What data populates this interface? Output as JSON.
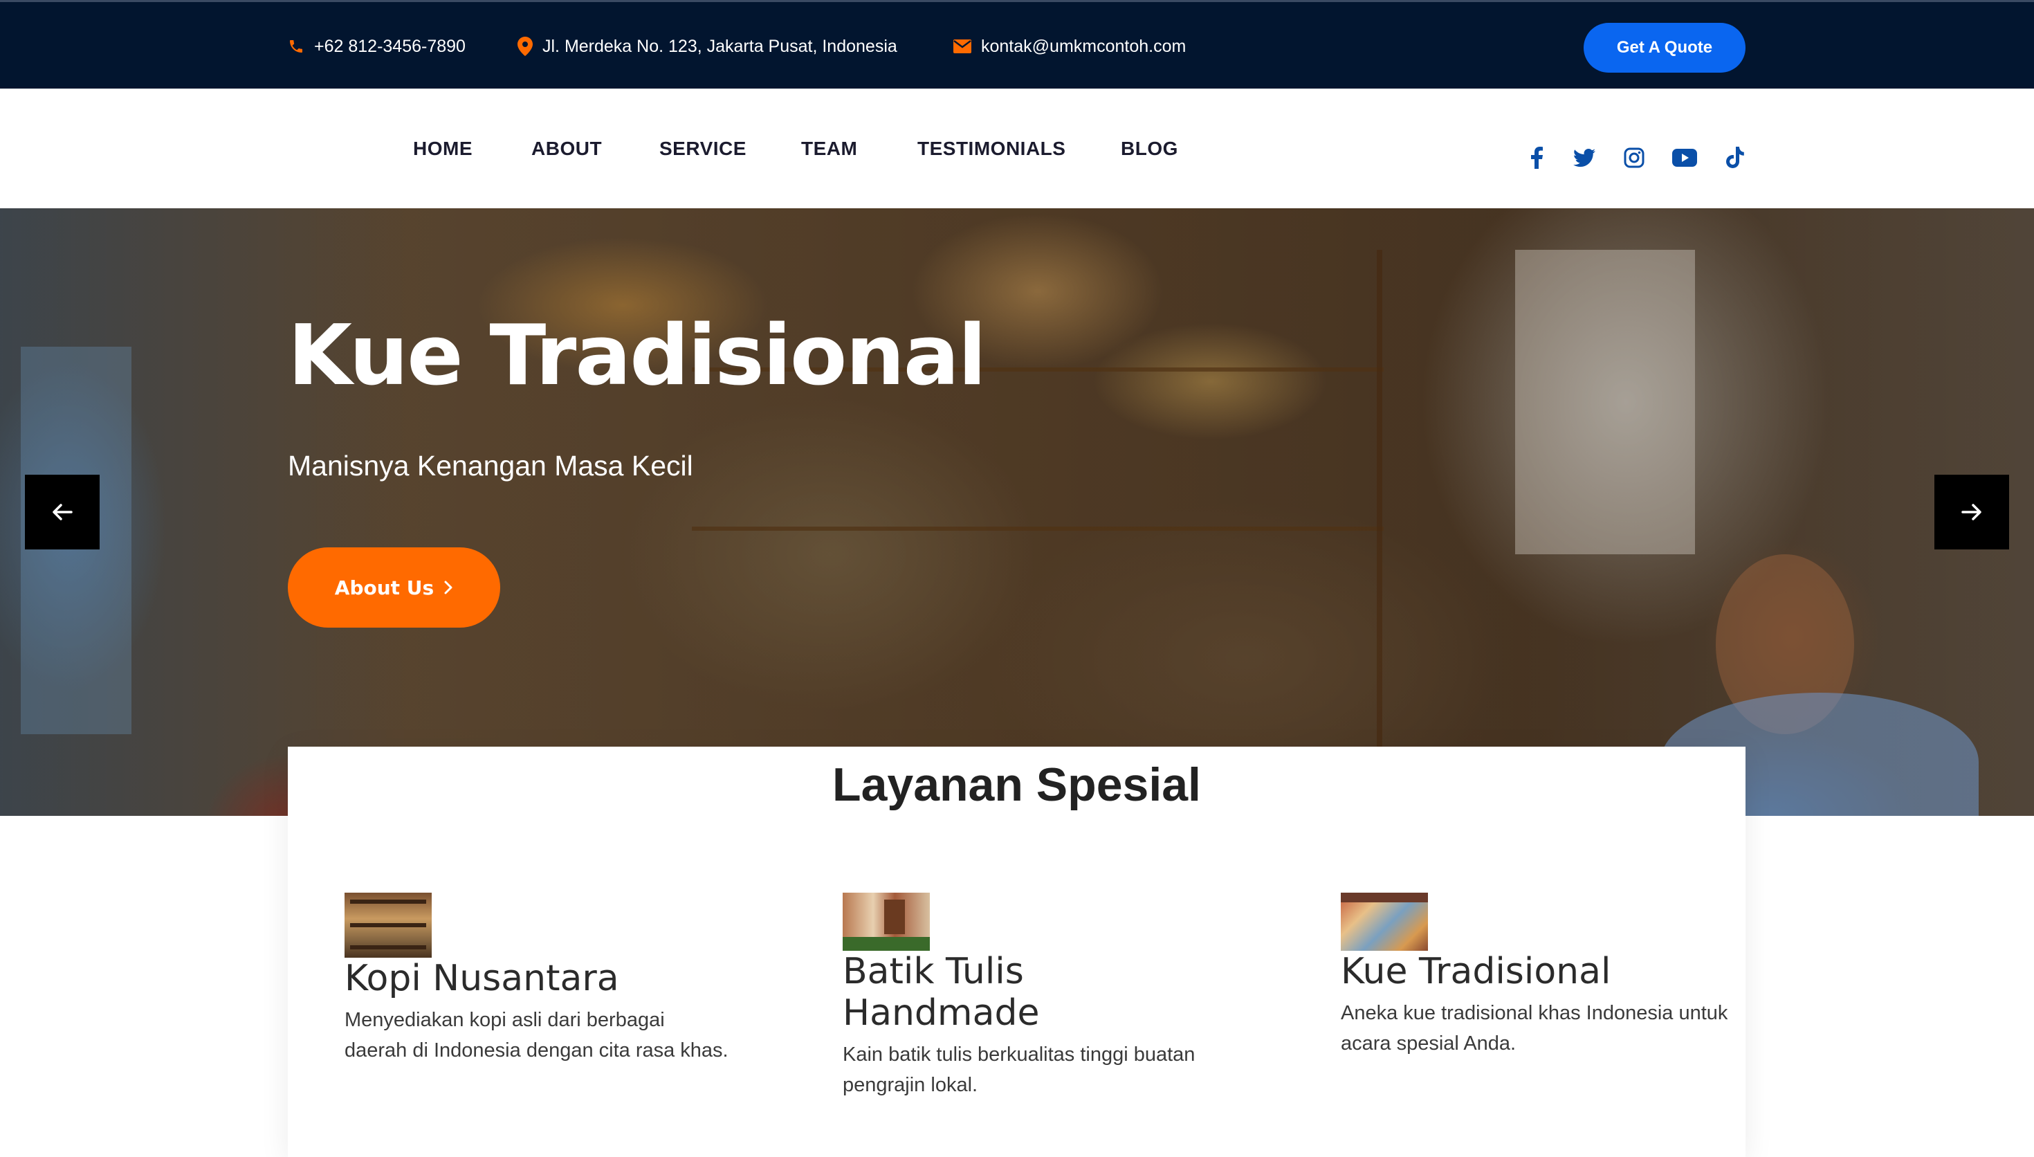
{
  "topbar": {
    "phone": "+62 812-3456-7890",
    "address": "Jl. Merdeka No. 123, Jakarta Pusat, Indonesia",
    "email": "kontak@umkmcontoh.com",
    "quote_label": "Get A Quote"
  },
  "nav": {
    "items": [
      "HOME",
      "ABOUT",
      "SERVICE",
      "TEAM",
      "TESTIMONIALS",
      "BLOG"
    ],
    "social_icons": [
      "facebook-icon",
      "twitter-icon",
      "instagram-icon",
      "youtube-icon",
      "tiktok-icon"
    ]
  },
  "hero": {
    "title": "Kue Tradisional",
    "subtitle": "Manisnya Kenangan Masa Kecil",
    "button_label": "About Us"
  },
  "services": {
    "title": "Layanan Spesial",
    "items": [
      {
        "title": "Kopi Nusantara",
        "description": "Menyediakan kopi asli dari berbagai daerah di Indonesia dengan cita rasa khas."
      },
      {
        "title": "Batik Tulis Handmade",
        "description": "Kain batik tulis berkualitas tinggi buatan pengrajin lokal."
      },
      {
        "title": "Kue Tradisional",
        "description": "Aneka kue tradisional khas Indonesia untuk acara spesial Anda."
      }
    ]
  },
  "colors": {
    "topbar_bg": "#02152f",
    "accent_blue": "#0a66f0",
    "accent_orange": "#ff6a00",
    "icon_orange": "#ff6a00",
    "social_blue": "#0a4fa8"
  }
}
